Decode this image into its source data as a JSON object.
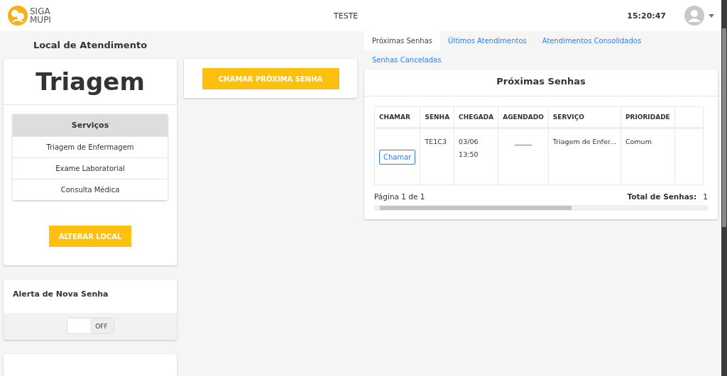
{
  "header": {
    "logo": [
      "SIGA",
      "MUPI"
    ],
    "title": "TESTE",
    "clock": "15:20:47"
  },
  "location": {
    "heading": "Local de Atendimento",
    "name": "Triagem",
    "services_title": "Serviços",
    "services": [
      "Triagem de Enfermagem",
      "Exame Laboratorial",
      "Consulta Médica"
    ],
    "change_button": "ALTERAR LOCAL"
  },
  "alert": {
    "title": "Alerta de Nova Senha",
    "toggle": {
      "on": false,
      "label": "OFF"
    }
  },
  "call_next_button": "CHAMAR PRÓXIMA SENHA",
  "tabs": [
    {
      "label": "Próximas Senhas",
      "selected": true
    },
    {
      "label": "Últimos Atendimentos",
      "selected": false
    },
    {
      "label": "Atendimentos Consolidados",
      "selected": false
    },
    {
      "label": "Senhas Canceladas",
      "selected": false
    }
  ],
  "panel": {
    "title": "Próximas Senhas",
    "table": {
      "columns": [
        "CHAMAR",
        "SENHA",
        "CHEGADA",
        "AGENDADO",
        "SERVIÇO",
        "PRIORIDADE"
      ],
      "rows": [
        {
          "button": "Chamar",
          "senha": "TE1C3",
          "chegada": [
            "03/06",
            "13:50"
          ],
          "agendado": "_____",
          "servico": "Triagem de Enfer...",
          "prioridade": "Comum"
        }
      ]
    },
    "page": "Página 1 de 1",
    "total_label": "Total de Senhas:",
    "total": "1"
  }
}
